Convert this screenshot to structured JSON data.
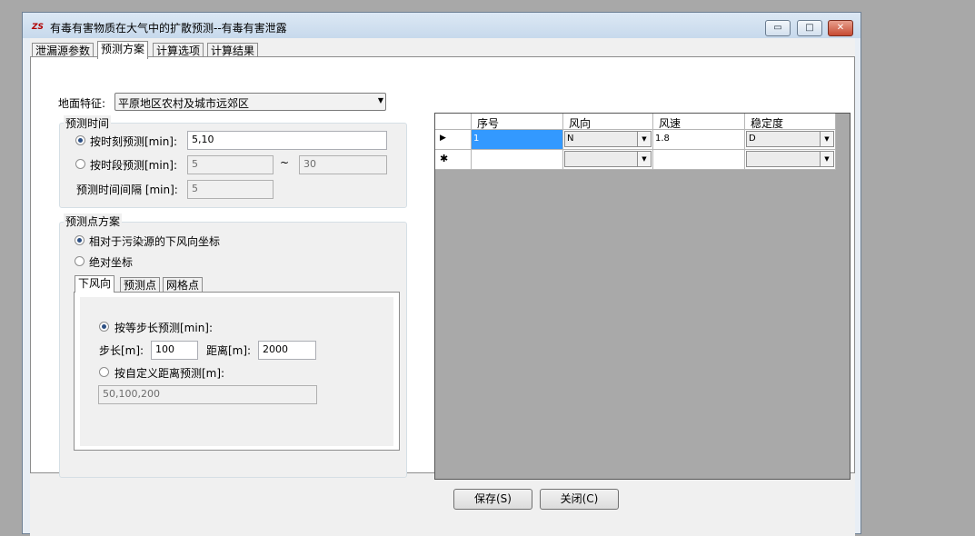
{
  "window": {
    "app_icon": "ZS",
    "title": "有毒有害物质在大气中的扩散预测--有毒有害泄露",
    "minimize_glyph": "▭",
    "maximize_glyph": "□",
    "close_glyph": "✕"
  },
  "tabs": [
    "泄漏源参数",
    "预测方案",
    "计算选项",
    "计算结果"
  ],
  "active_tab": "预测方案",
  "terrain": {
    "label": "地面特征:",
    "value": "平原地区农村及城市远郊区"
  },
  "time_group": {
    "title": "预测时间",
    "by_moment": {
      "label": "按时刻预测[min]:",
      "value": "5,10",
      "checked": true
    },
    "by_period": {
      "label": "按时段预测[min]:",
      "from": "5",
      "tilde": "~",
      "to": "30",
      "checked": false
    },
    "interval": {
      "label": "预测时间间隔 [min]:",
      "value": "5"
    }
  },
  "point_group": {
    "title": "预测点方案",
    "relative": {
      "label": "相对于污染源的下风向坐标",
      "checked": true
    },
    "absolute": {
      "label": "绝对坐标",
      "checked": false
    },
    "subtabs": [
      "下风向",
      "预测点",
      "网格点"
    ],
    "active_subtab": "下风向",
    "equal_step": {
      "label": "按等步长预测[min]:",
      "checked": true
    },
    "step": {
      "label": "步长[m]:",
      "value": "100"
    },
    "distance": {
      "label": "距离[m]:",
      "value": "2000"
    },
    "custom": {
      "label": "按自定义距离预测[m]:",
      "value": "50,100,200",
      "checked": false
    }
  },
  "grid": {
    "columns": [
      "序号",
      "风向",
      "风速",
      "稳定度"
    ],
    "rows": [
      {
        "marker": "▶",
        "seq": "1",
        "direction": "N",
        "speed": "1.8",
        "stability": "D"
      },
      {
        "marker": "✱",
        "seq": "",
        "direction": "",
        "speed": "",
        "stability": ""
      }
    ]
  },
  "buttons": {
    "save": "保存(S)",
    "close": "关闭(C)"
  },
  "icons": {
    "dropdown": "▼"
  }
}
